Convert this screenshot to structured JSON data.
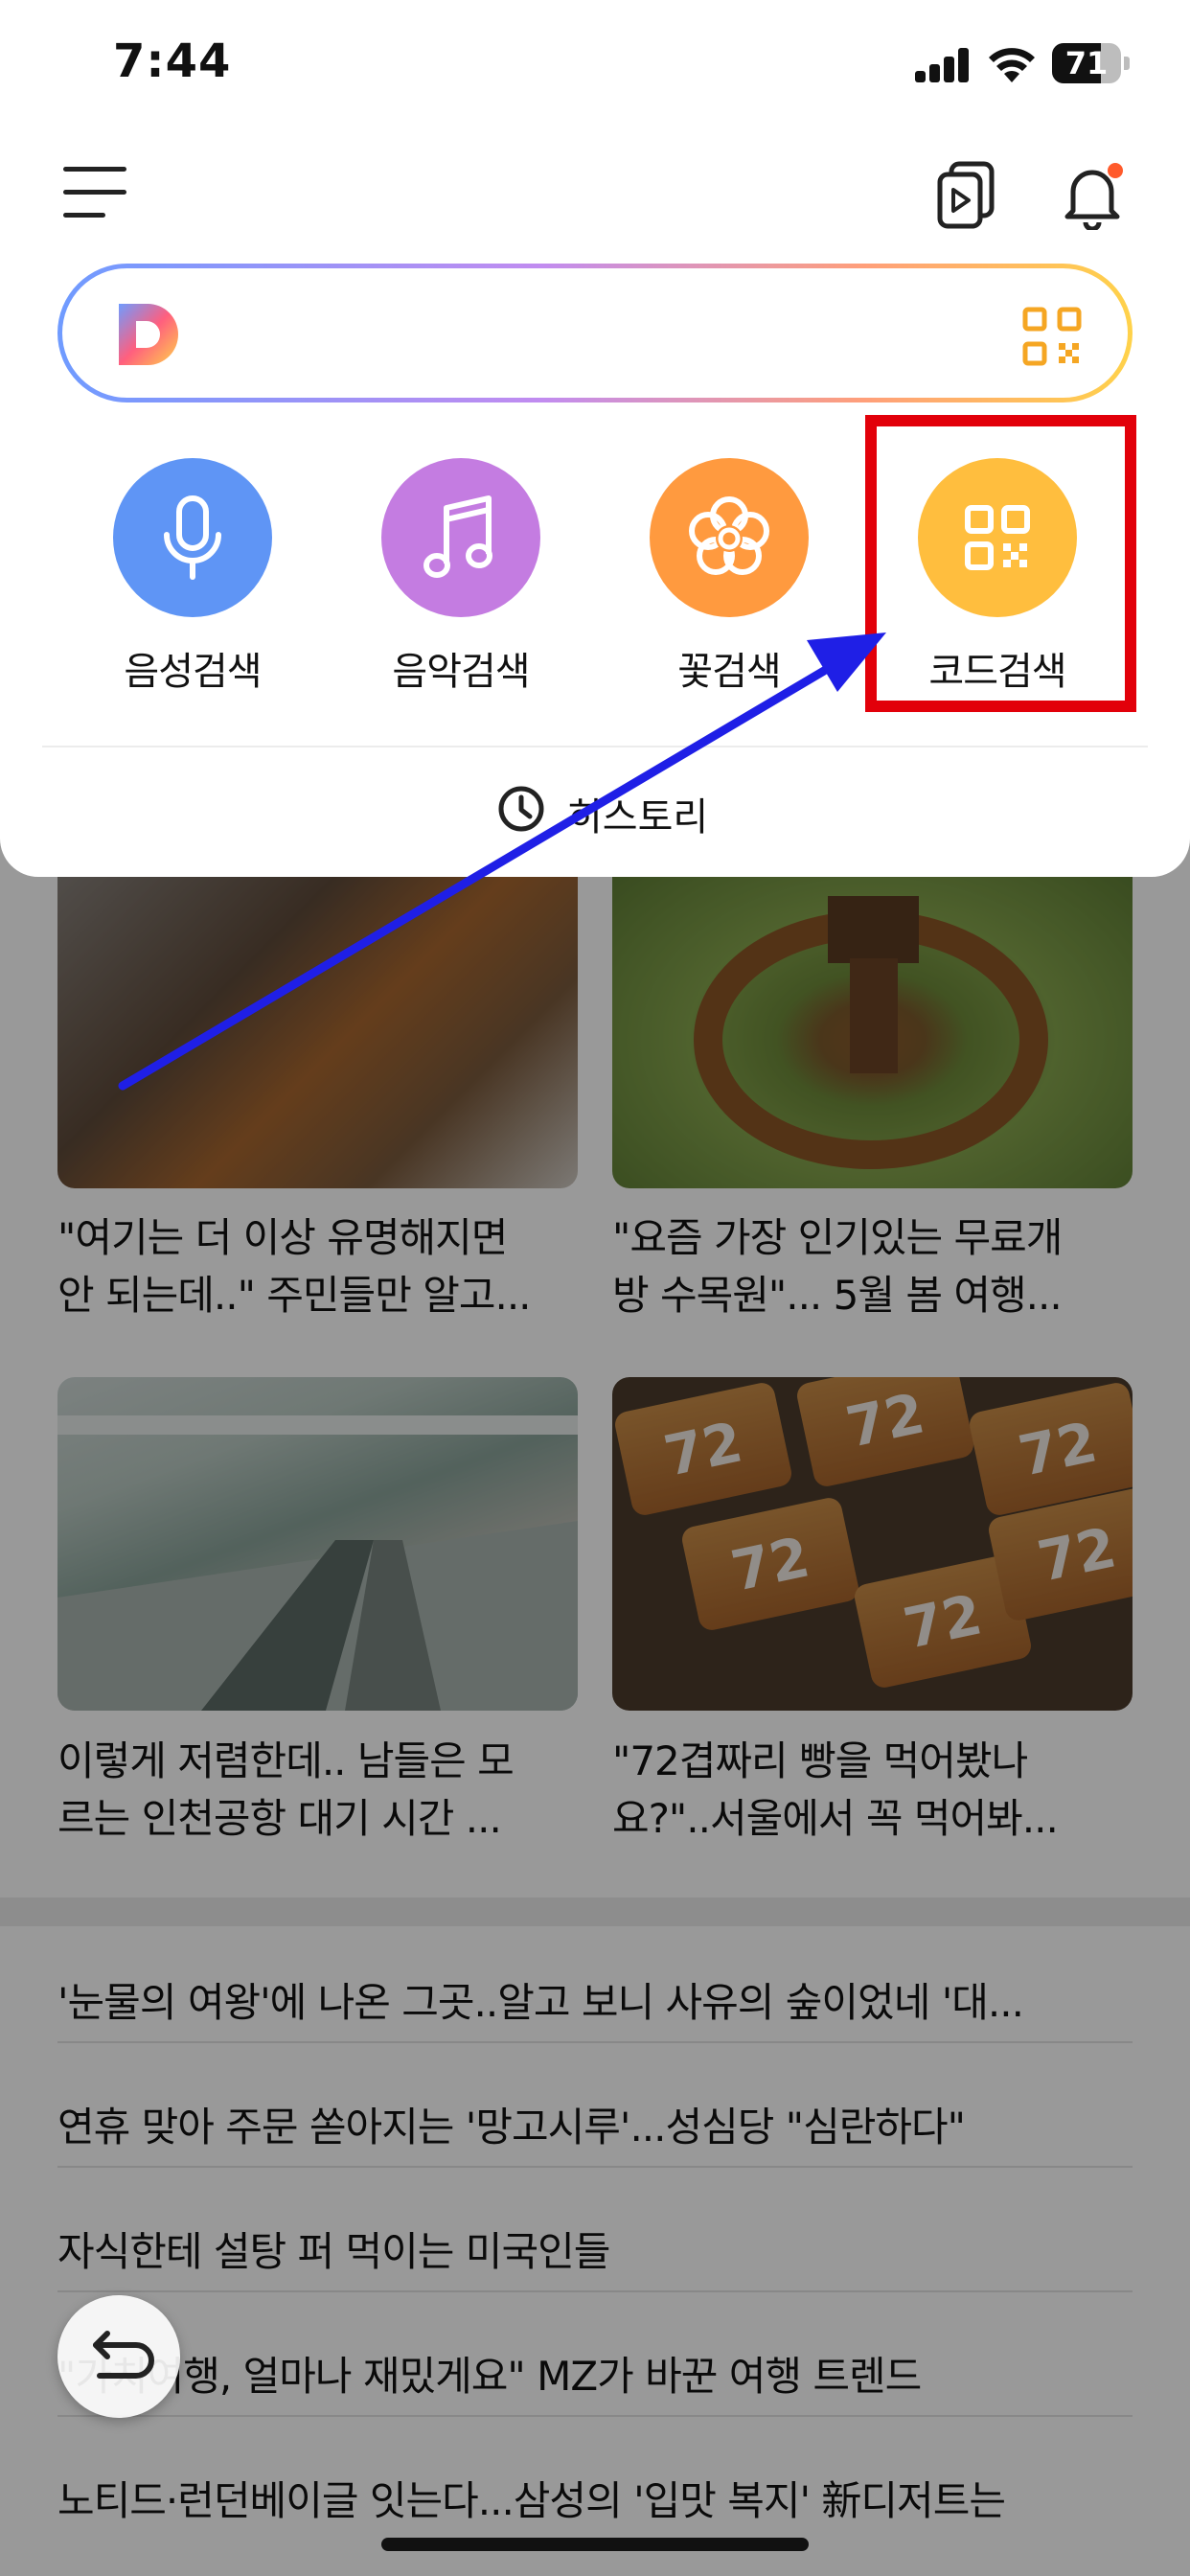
{
  "status_bar": {
    "time": "7:44",
    "battery": "71",
    "battery_level": 0.71
  },
  "search": {
    "logo_letter": "D",
    "placeholder": ""
  },
  "tools": [
    {
      "label": "음성검색",
      "icon": "microphone-icon"
    },
    {
      "label": "음악검색",
      "icon": "music-note-icon"
    },
    {
      "label": "꽃검색",
      "icon": "flower-icon"
    },
    {
      "label": "코드검색",
      "icon": "qr-code-icon"
    }
  ],
  "history": {
    "label": "히스토리",
    "icon": "clock-icon"
  },
  "cards": [
    {
      "title": "\"여기는 더 이상 유명해지면\n안 되는데..\" 주민들만 알고..."
    },
    {
      "title": "\"요즘 가장 인기있는 무료개\n방 수목원\"... 5월 봄 여행..."
    },
    {
      "title": "이렇게 저렴한데.. 남들은 모\n르는 인천공항 대기 시간 ..."
    },
    {
      "title": "\"72겹짜리 빵을 먹어봤나\n요?\"..서울에서 꼭 먹어봐..."
    }
  ],
  "bread_label": "72",
  "news": [
    "'눈물의 여왕'에 나온 그곳..알고 보니 사유의 숲이었네 '대...",
    "연휴 맞아 주문 쏟아지는 '망고시루'...성심당 \"심란하다\"",
    "자식한테 설탕 퍼 먹이는 미국인들",
    "\"가치여행, 얼마나 재밌게요\" MZ가 바꾼 여행 트렌드",
    "노티드·런던베이글 잇는다...삼성의 '입맛 복지' 新디저트는"
  ],
  "colors": {
    "voice": "#5f95f5",
    "music": "#c47ce1",
    "flower": "#ff9a3f",
    "code": "#ffbe3e",
    "highlight": "#e2000a",
    "arrow": "#1f1fe6"
  }
}
